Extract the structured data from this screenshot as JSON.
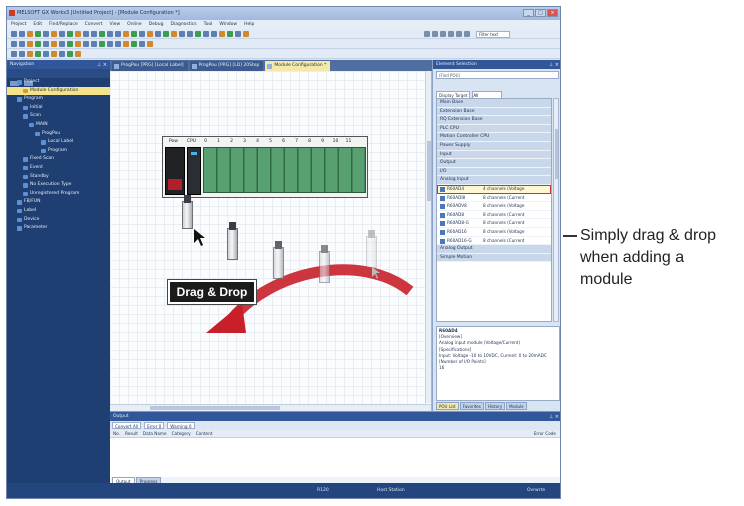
{
  "window": {
    "title": "MELSOFT GX Works3 [Untitled Project] - [Module Configuration *]",
    "controls": [
      "_",
      "□",
      "×"
    ]
  },
  "menu": [
    "Project",
    "Edit",
    "Find/Replace",
    "Convert",
    "View",
    "Online",
    "Debug",
    "Diagnostics",
    "Tool",
    "Window",
    "Help"
  ],
  "toolbar": {
    "search_placeholder": "Filter text"
  },
  "navigation": {
    "header": "Navigation",
    "items": [
      {
        "label": "Project",
        "indent": 1
      },
      {
        "label": "Module Configuration",
        "indent": 2,
        "selected": true
      },
      {
        "label": "Program",
        "indent": 1
      },
      {
        "label": "Initial",
        "indent": 2
      },
      {
        "label": "Scan",
        "indent": 2
      },
      {
        "label": "MAIN",
        "indent": 3
      },
      {
        "label": "ProgPou",
        "indent": 4
      },
      {
        "label": "Local Label",
        "indent": 5
      },
      {
        "label": "Program",
        "indent": 5
      },
      {
        "label": "Fixed Scan",
        "indent": 2
      },
      {
        "label": "Event",
        "indent": 2
      },
      {
        "label": "Standby",
        "indent": 2
      },
      {
        "label": "No Execution Type",
        "indent": 2
      },
      {
        "label": "Unregistered Program",
        "indent": 2
      },
      {
        "label": "FB/FUN",
        "indent": 1
      },
      {
        "label": "Label",
        "indent": 1
      },
      {
        "label": "Device",
        "indent": 1
      },
      {
        "label": "Parameter",
        "indent": 1
      }
    ]
  },
  "tabs": [
    {
      "label": "ProgPou [PRG] [Local Label]",
      "active": false
    },
    {
      "label": "ProgPou [PRG] [LD] 20Step",
      "active": false
    },
    {
      "label": "Module Configuration *",
      "active": true
    }
  ],
  "canvas": {
    "base_header": [
      "Pow",
      "CPU",
      "0",
      "1",
      "2",
      "3",
      "4",
      "5",
      "6",
      "7",
      "8",
      "9",
      "10",
      "11"
    ],
    "drag_label": "Drag & Drop"
  },
  "element_selection": {
    "header": "Element Selection",
    "search_placeholder": "(Find POU)",
    "display_target_label": "Display Target",
    "display_target_value": "All",
    "categories_top": [
      "Main Base",
      "Extension Base",
      "RQ Extension Base",
      "PLC CPU",
      "Motion Controller CPU",
      "Power Supply",
      "Input",
      "Output",
      "I/O",
      "Analog Input"
    ],
    "modules": [
      {
        "name": "R60AD4",
        "desc": "4 channels (Voltage",
        "highlight": true
      },
      {
        "name": "R60ADI8",
        "desc": "8 channels (Current"
      },
      {
        "name": "R60ADV8",
        "desc": "8 channels (Voltage"
      },
      {
        "name": "R60AD8",
        "desc": "8 channels (Current"
      },
      {
        "name": "R60AD8-G",
        "desc": "8 channels (Current"
      },
      {
        "name": "R60AD16",
        "desc": "8 channels (Voltage"
      },
      {
        "name": "R60AD16-G",
        "desc": "8 channels (Current"
      }
    ],
    "categories_bottom": [
      "Analog Output",
      "Simple Motion"
    ],
    "description": {
      "title": "R60AD4",
      "lines": [
        "[Overview]",
        "Analog input module (Voltage/Current)",
        "[Specifications]",
        "Input: Voltage -10 to 10VDC, Current: 0 to 20mADC",
        "[Number of I/O Points]",
        "16"
      ]
    },
    "tabs": [
      "POU List",
      "Favorites",
      "History",
      "Module"
    ]
  },
  "output": {
    "header": "Output",
    "tools": [
      "Convert All",
      "Error 0",
      "Warning 0"
    ],
    "columns": [
      "No.",
      "Result",
      "Data Name",
      "Category",
      "Content"
    ],
    "error_code_column": "Error Code",
    "tabs": [
      "Output",
      "Progress"
    ]
  },
  "statusbar": {
    "cpu": "R120",
    "host": "Host Station",
    "mode": "Ovrwrte"
  },
  "callout": {
    "lines": [
      "Simply drag & drop",
      "when adding a",
      "module"
    ]
  },
  "colors": {
    "accent_red": "#c8202a",
    "nav_bg": "#1f3f73",
    "slot_green": "#58a070"
  }
}
